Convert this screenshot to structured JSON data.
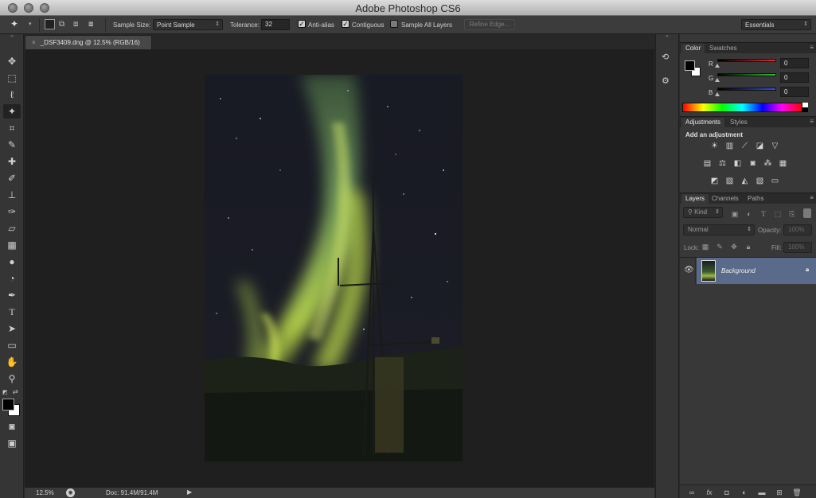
{
  "app": {
    "title": "Adobe Photoshop CS6"
  },
  "options_bar": {
    "sample_size_label": "Sample Size:",
    "sample_size_value": "Point Sample",
    "tolerance_label": "Tolerance:",
    "tolerance_value": "32",
    "anti_alias_label": "Anti-alias",
    "contiguous_label": "Contiguous",
    "sample_all_layers_label": "Sample All Layers",
    "refine_edge_label": "Refine Edge...",
    "workspace_value": "Essentials",
    "anti_alias_checked": true,
    "contiguous_checked": true,
    "sample_all_layers_checked": false
  },
  "document": {
    "tab_title": "_DSF3409.dng @ 12.5% (RGB/16)",
    "close_glyph": "×"
  },
  "status_bar": {
    "zoom": "12.5%",
    "doc_info": "Doc: 91.4M/91.4M"
  },
  "color_panel": {
    "tabs": [
      "Color",
      "Swatches"
    ],
    "channels": [
      {
        "label": "R",
        "value": "0",
        "color": "#e03030"
      },
      {
        "label": "G",
        "value": "0",
        "color": "#30c030"
      },
      {
        "label": "B",
        "value": "0",
        "color": "#3050e0"
      }
    ]
  },
  "adjustments_panel": {
    "tabs": [
      "Adjustments",
      "Styles"
    ],
    "heading": "Add an adjustment"
  },
  "layers_panel": {
    "tabs": [
      "Layers",
      "Channels",
      "Paths"
    ],
    "kind_label": "Kind",
    "blend_mode": "Normal",
    "opacity_label": "Opacity:",
    "opacity_value": "100%",
    "lock_label": "Lock:",
    "fill_label": "Fill:",
    "fill_value": "100%",
    "layers": [
      {
        "name": "Background",
        "visible": true,
        "locked": true,
        "selected": true
      }
    ]
  },
  "colors": {
    "foreground": "#000000",
    "background": "#ffffff",
    "selection": "#5a6a8a"
  }
}
